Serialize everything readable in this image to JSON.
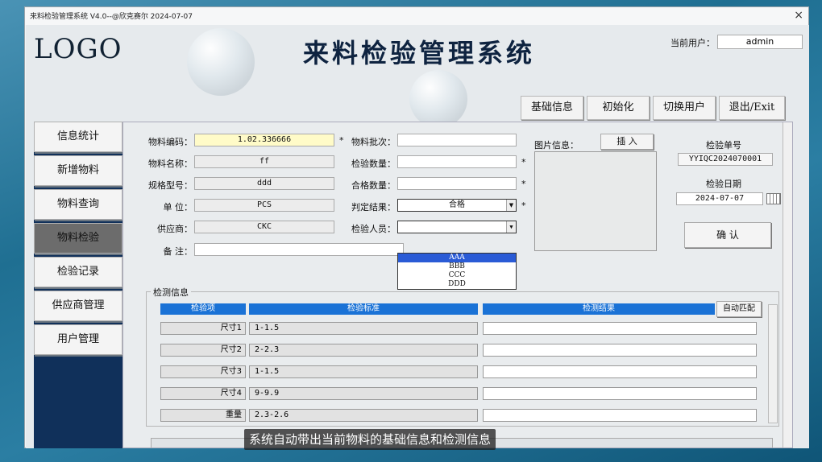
{
  "window": {
    "title": "来料检验管理系统 V4.0--@欣克赛尔  2024-07-07",
    "close_glyph": "×"
  },
  "header": {
    "logo": "LOGO",
    "app_title": "来料检验管理系统",
    "user_label": "当前用户：",
    "user_value": "admin"
  },
  "top_buttons": {
    "basic": "基础信息",
    "init": "初始化",
    "switch_user": "切换用户",
    "exit": "退出/Exit"
  },
  "sidebar": {
    "items": [
      {
        "label": "信息统计"
      },
      {
        "label": "新增物料"
      },
      {
        "label": "物料查询"
      },
      {
        "label": "物料检验"
      },
      {
        "label": "检验记录"
      },
      {
        "label": "供应商管理"
      },
      {
        "label": "用户管理"
      }
    ],
    "active_index": 3
  },
  "form": {
    "material_code": {
      "label": "物料编码：",
      "value": "1.02.336666"
    },
    "material_name": {
      "label": "物料名称：",
      "value": "ff"
    },
    "spec": {
      "label": "规格型号：",
      "value": "ddd"
    },
    "unit": {
      "label": "单  位：",
      "value": "PCS"
    },
    "supplier": {
      "label": "供应商：",
      "value": "CKC"
    },
    "remark": {
      "label": "备  注：",
      "value": ""
    },
    "batch": {
      "label": "物料批次：",
      "value": ""
    },
    "inspect_qty": {
      "label": "检验数量：",
      "value": ""
    },
    "pass_qty": {
      "label": "合格数量：",
      "value": ""
    },
    "judgement": {
      "label": "判定结果：",
      "value": "合格"
    },
    "inspector": {
      "label": "检验人员：",
      "value": ""
    },
    "star": "*"
  },
  "inspector_options": [
    "AAA",
    "BBB",
    "CCC",
    "DDD"
  ],
  "picture": {
    "label": "图片信息：",
    "insert_label": "插  入"
  },
  "inspection": {
    "no_label": "检验单号",
    "no_value": "YYIQC2024070001",
    "date_label": "检验日期",
    "date_value": "2024-07-07",
    "confirm_label": "确  认"
  },
  "detection": {
    "title": "检测信息",
    "headers": [
      "检验项",
      "检验标准",
      "检测结果"
    ],
    "auto_match_label": "自动匹配",
    "rows": [
      {
        "item": "尺寸1",
        "standard": "1-1.5"
      },
      {
        "item": "尺寸2",
        "standard": "2-2.3"
      },
      {
        "item": "尺寸3",
        "standard": "1-1.5"
      },
      {
        "item": "尺寸4",
        "standard": "9-9.9"
      },
      {
        "item": "重量",
        "standard": "2.3-2.6"
      }
    ]
  },
  "subtitle": "系统自动带出当前物料的基础信息和检测信息",
  "colors": {
    "header_blue": "#1a72d6",
    "sidebar_bg": "#10305a",
    "code_highlight": "#fffbc8",
    "selected_option": "#2a5bd6"
  }
}
